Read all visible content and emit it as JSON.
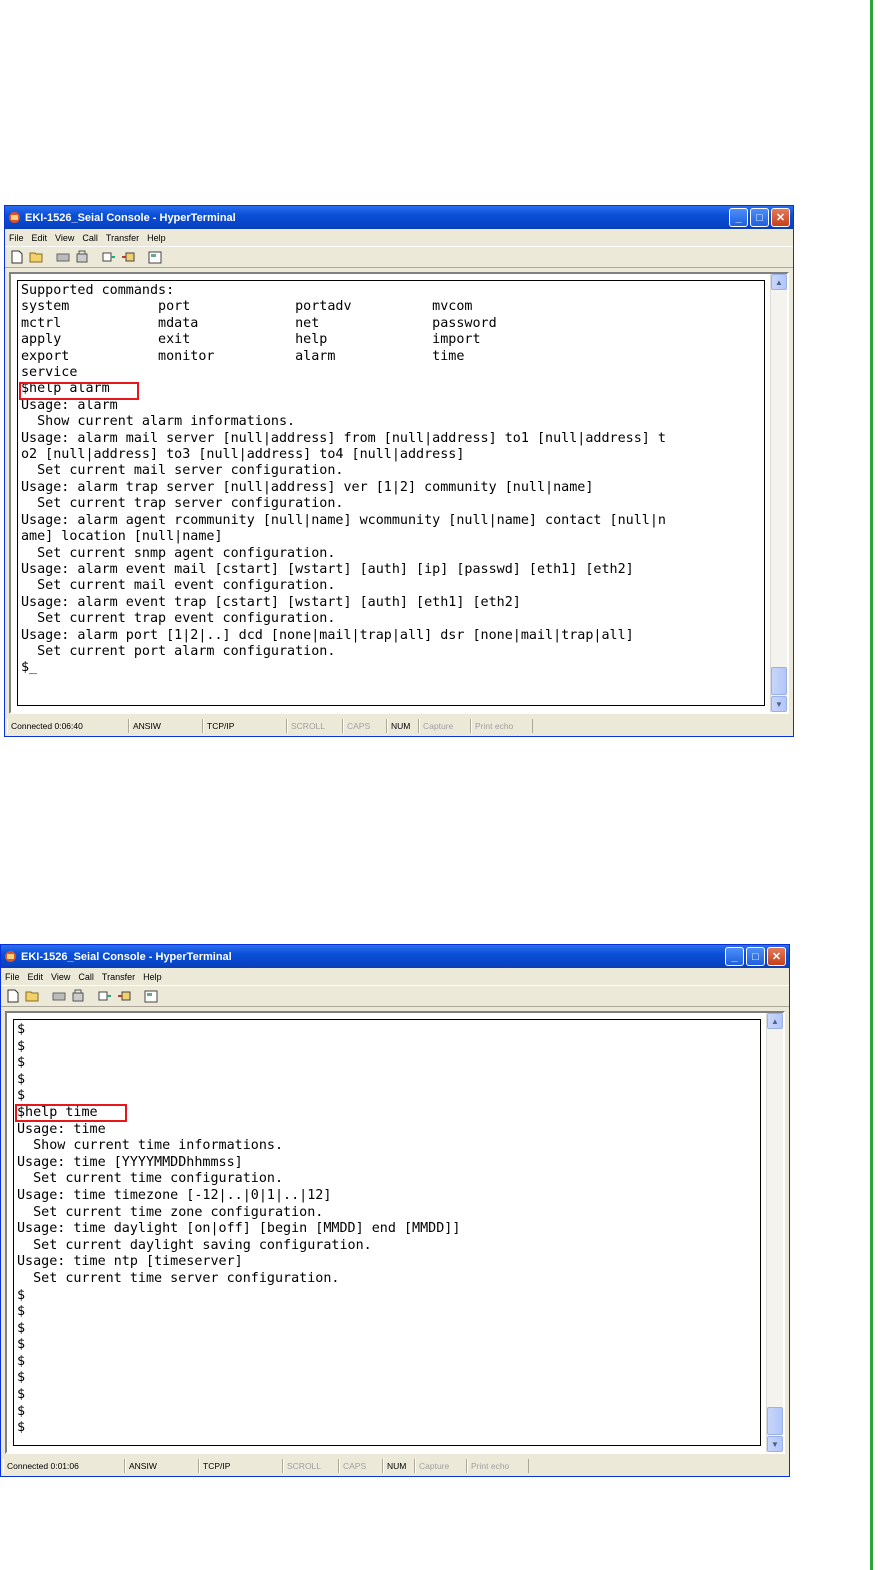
{
  "windows": [
    {
      "title": "EKI-1526_Seial Console - HyperTerminal",
      "menu": [
        "File",
        "Edit",
        "View",
        "Call",
        "Transfer",
        "Help"
      ],
      "terminal_lines": [
        "Supported commands:",
        "system           port             portadv          mvcom",
        "mctrl            mdata            net              password",
        "apply            exit             help             import",
        "export           monitor          alarm            time",
        "service",
        "$help alarm",
        "Usage: alarm",
        "  Show current alarm informations.",
        "Usage: alarm mail server [null|address] from [null|address] to1 [null|address] t",
        "o2 [null|address] to3 [null|address] to4 [null|address]",
        "  Set current mail server configuration.",
        "Usage: alarm trap server [null|address] ver [1|2] community [null|name]",
        "  Set current trap server configuration.",
        "Usage: alarm agent rcommunity [null|name] wcommunity [null|name] contact [null|n",
        "ame] location [null|name]",
        "  Set current snmp agent configuration.",
        "Usage: alarm event mail [cstart] [wstart] [auth] [ip] [passwd] [eth1] [eth2]",
        "  Set current mail event configuration.",
        "Usage: alarm event trap [cstart] [wstart] [auth] [eth1] [eth2]",
        "  Set current trap event configuration.",
        "Usage: alarm port [1|2|..] dcd [none|mail|trap|all] dsr [none|mail|trap|all]",
        "  Set current port alarm configuration.",
        "$_"
      ],
      "status": {
        "connected": "Connected 0:06:40",
        "emulation": "ANSIW",
        "protocol": "TCP/IP",
        "scroll": "SCROLL",
        "caps": "CAPS",
        "num": "NUM",
        "capture": "Capture",
        "print_echo": "Print echo"
      }
    },
    {
      "title": "EKI-1526_Seial Console - HyperTerminal",
      "menu": [
        "File",
        "Edit",
        "View",
        "Call",
        "Transfer",
        "Help"
      ],
      "terminal_lines": [
        "$",
        "$",
        "$",
        "$",
        "$",
        "$help time",
        "Usage: time",
        "  Show current time informations.",
        "Usage: time [YYYYMMDDhhmmss]",
        "  Set current time configuration.",
        "Usage: time timezone [-12|..|0|1|..|12]",
        "  Set current time zone configuration.",
        "Usage: time daylight [on|off] [begin [MMDD] end [MMDD]]",
        "  Set current daylight saving configuration.",
        "Usage: time ntp [timeserver]",
        "  Set current time server configuration.",
        "$",
        "$",
        "$",
        "$",
        "$",
        "$",
        "$",
        "$",
        "$"
      ],
      "status": {
        "connected": "Connected 0:01:06",
        "emulation": "ANSIW",
        "protocol": "TCP/IP",
        "scroll": "SCROLL",
        "caps": "CAPS",
        "num": "NUM",
        "capture": "Capture",
        "print_echo": "Print echo"
      }
    }
  ],
  "icons": {
    "toolbar": [
      "new-icon",
      "open-icon",
      "disconnect-icon",
      "dial-icon",
      "send-icon",
      "receive-icon",
      "properties-icon"
    ],
    "title_buttons": [
      "minimize-icon",
      "maximize-icon",
      "close-icon"
    ]
  },
  "colors": {
    "titlebar": "#0a4fd6",
    "highlight_box": "#e8151b",
    "page_rule": "#2ea33b"
  }
}
